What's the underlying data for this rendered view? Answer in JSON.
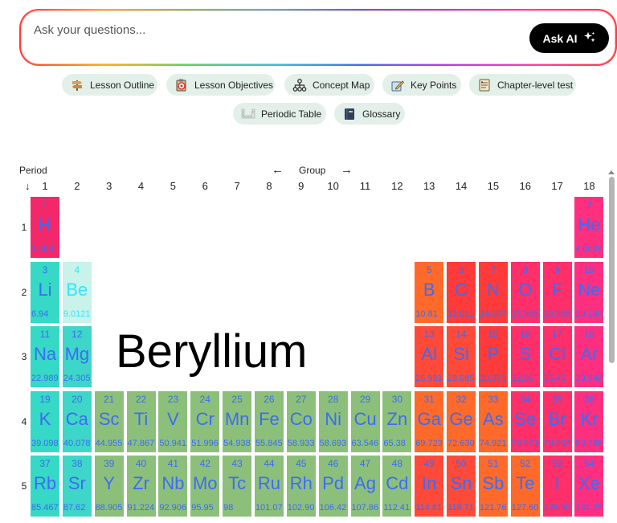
{
  "ask": {
    "placeholder": "Ask your questions...",
    "button_label": "Ask AI",
    "button_icon": "sparkles-icon"
  },
  "chips": [
    {
      "label": "Lesson Outline",
      "icon": "signpost-icon"
    },
    {
      "label": "Lesson Objectives",
      "icon": "target-clipboard-icon"
    },
    {
      "label": "Concept Map",
      "icon": "hierarchy-icon"
    },
    {
      "label": "Key Points",
      "icon": "pencil-note-icon"
    },
    {
      "label": "Chapter-level test",
      "icon": "test-sheet-icon"
    },
    {
      "label": "Periodic Table",
      "icon": "periodic-grid-icon"
    },
    {
      "label": "Glossary",
      "icon": "book-icon"
    }
  ],
  "table": {
    "period_label": "Period",
    "period_arrow": "↓",
    "group_label": "Group",
    "group_left_arrow": "←",
    "group_right_arrow": "→",
    "groups": [
      "1",
      "2",
      "3",
      "4",
      "5",
      "6",
      "7",
      "8",
      "9",
      "10",
      "11",
      "12",
      "13",
      "14",
      "15",
      "16",
      "17",
      "18"
    ],
    "periods": [
      "1",
      "2",
      "3",
      "4",
      "5"
    ],
    "hover_name": "Beryllium",
    "colors": {
      "alkali": "#36d8c6",
      "alkaline": "#3ed6c8",
      "beryllium": "#c8f2ea",
      "transition": "#8cc07a",
      "post_transition": "#ff6a2a",
      "metalloid": "#ff4a3a",
      "nonmetal": "#ff3a3a",
      "halogen": "#ff2f6a",
      "noble": "#ff2f80",
      "hydrogen": "#f2286a"
    },
    "elements": [
      {
        "z": "1",
        "sym": "H",
        "mass": "1.008",
        "group": 1,
        "period": 1,
        "color": "hydrogen"
      },
      {
        "z": "2",
        "sym": "He",
        "mass": "4.0026",
        "group": 18,
        "period": 1,
        "color": "noble"
      },
      {
        "z": "3",
        "sym": "Li",
        "mass": "6.94",
        "group": 1,
        "period": 2,
        "color": "alkali"
      },
      {
        "z": "4",
        "sym": "Be",
        "mass": "9.0121",
        "group": 2,
        "period": 2,
        "color": "beryllium",
        "light": true
      },
      {
        "z": "5",
        "sym": "B",
        "mass": "10.81",
        "group": 13,
        "period": 2,
        "color": "post_transition"
      },
      {
        "z": "6",
        "sym": "C",
        "mass": "12.011",
        "group": 14,
        "period": 2,
        "color": "nonmetal"
      },
      {
        "z": "7",
        "sym": "N",
        "mass": "14.007",
        "group": 15,
        "period": 2,
        "color": "nonmetal"
      },
      {
        "z": "8",
        "sym": "O",
        "mass": "15.999",
        "group": 16,
        "period": 2,
        "color": "halogen"
      },
      {
        "z": "9",
        "sym": "F",
        "mass": "18.998",
        "group": 17,
        "period": 2,
        "color": "halogen"
      },
      {
        "z": "10",
        "sym": "Ne",
        "mass": "20.180",
        "group": 18,
        "period": 2,
        "color": "noble"
      },
      {
        "z": "11",
        "sym": "Na",
        "mass": "22.989",
        "group": 1,
        "period": 3,
        "color": "alkali"
      },
      {
        "z": "12",
        "sym": "Mg",
        "mass": "24.305",
        "group": 2,
        "period": 3,
        "color": "alkaline"
      },
      {
        "z": "13",
        "sym": "Al",
        "mass": "26.981",
        "group": 13,
        "period": 3,
        "color": "metalloid"
      },
      {
        "z": "14",
        "sym": "Si",
        "mass": "28.085",
        "group": 14,
        "period": 3,
        "color": "metalloid"
      },
      {
        "z": "15",
        "sym": "P",
        "mass": "30.973",
        "group": 15,
        "period": 3,
        "color": "nonmetal"
      },
      {
        "z": "16",
        "sym": "S",
        "mass": "32.06",
        "group": 16,
        "period": 3,
        "color": "halogen"
      },
      {
        "z": "17",
        "sym": "Cl",
        "mass": "35.45",
        "group": 17,
        "period": 3,
        "color": "halogen"
      },
      {
        "z": "18",
        "sym": "Ar",
        "mass": "39.948",
        "group": 18,
        "period": 3,
        "color": "noble"
      },
      {
        "z": "19",
        "sym": "K",
        "mass": "39.098",
        "group": 1,
        "period": 4,
        "color": "alkali"
      },
      {
        "z": "20",
        "sym": "Ca",
        "mass": "40.078",
        "group": 2,
        "period": 4,
        "color": "alkaline"
      },
      {
        "z": "21",
        "sym": "Sc",
        "mass": "44.955",
        "group": 3,
        "period": 4,
        "color": "transition"
      },
      {
        "z": "22",
        "sym": "Ti",
        "mass": "47.867",
        "group": 4,
        "period": 4,
        "color": "transition"
      },
      {
        "z": "23",
        "sym": "V",
        "mass": "50.941",
        "group": 5,
        "period": 4,
        "color": "transition"
      },
      {
        "z": "24",
        "sym": "Cr",
        "mass": "51.996",
        "group": 6,
        "period": 4,
        "color": "transition"
      },
      {
        "z": "25",
        "sym": "Mn",
        "mass": "54.938",
        "group": 7,
        "period": 4,
        "color": "transition"
      },
      {
        "z": "26",
        "sym": "Fe",
        "mass": "55.845",
        "group": 8,
        "period": 4,
        "color": "transition"
      },
      {
        "z": "27",
        "sym": "Co",
        "mass": "58.933",
        "group": 9,
        "period": 4,
        "color": "transition"
      },
      {
        "z": "28",
        "sym": "Ni",
        "mass": "58.693",
        "group": 10,
        "period": 4,
        "color": "transition"
      },
      {
        "z": "29",
        "sym": "Cu",
        "mass": "63.546",
        "group": 11,
        "period": 4,
        "color": "transition"
      },
      {
        "z": "30",
        "sym": "Zn",
        "mass": "65.38",
        "group": 12,
        "period": 4,
        "color": "transition"
      },
      {
        "z": "31",
        "sym": "Ga",
        "mass": "69.723",
        "group": 13,
        "period": 4,
        "color": "post_transition"
      },
      {
        "z": "32",
        "sym": "Ge",
        "mass": "72.630",
        "group": 14,
        "period": 4,
        "color": "post_transition"
      },
      {
        "z": "33",
        "sym": "As",
        "mass": "74.921",
        "group": 15,
        "period": 4,
        "color": "post_transition"
      },
      {
        "z": "34",
        "sym": "Se",
        "mass": "78.971",
        "group": 16,
        "period": 4,
        "color": "halogen"
      },
      {
        "z": "35",
        "sym": "Br",
        "mass": "79.904",
        "group": 17,
        "period": 4,
        "color": "halogen"
      },
      {
        "z": "36",
        "sym": "Kr",
        "mass": "83.798",
        "group": 18,
        "period": 4,
        "color": "noble"
      },
      {
        "z": "37",
        "sym": "Rb",
        "mass": "85.467",
        "group": 1,
        "period": 5,
        "color": "alkali"
      },
      {
        "z": "38",
        "sym": "Sr",
        "mass": "87.62",
        "group": 2,
        "period": 5,
        "color": "alkaline"
      },
      {
        "z": "39",
        "sym": "Y",
        "mass": "88.905",
        "group": 3,
        "period": 5,
        "color": "transition"
      },
      {
        "z": "40",
        "sym": "Zr",
        "mass": "91.224",
        "group": 4,
        "period": 5,
        "color": "transition"
      },
      {
        "z": "41",
        "sym": "Nb",
        "mass": "92.906",
        "group": 5,
        "period": 5,
        "color": "transition"
      },
      {
        "z": "42",
        "sym": "Mo",
        "mass": "95.95",
        "group": 6,
        "period": 5,
        "color": "transition"
      },
      {
        "z": "43",
        "sym": "Tc",
        "mass": "98",
        "group": 7,
        "period": 5,
        "color": "transition"
      },
      {
        "z": "44",
        "sym": "Ru",
        "mass": "101.07",
        "group": 8,
        "period": 5,
        "color": "transition"
      },
      {
        "z": "45",
        "sym": "Rh",
        "mass": "102.90",
        "group": 9,
        "period": 5,
        "color": "transition"
      },
      {
        "z": "46",
        "sym": "Pd",
        "mass": "106.42",
        "group": 10,
        "period": 5,
        "color": "transition"
      },
      {
        "z": "47",
        "sym": "Ag",
        "mass": "107.86",
        "group": 11,
        "period": 5,
        "color": "transition"
      },
      {
        "z": "48",
        "sym": "Cd",
        "mass": "112.41",
        "group": 12,
        "period": 5,
        "color": "transition"
      },
      {
        "z": "49",
        "sym": "In",
        "mass": "114.81",
        "group": 13,
        "period": 5,
        "color": "metalloid"
      },
      {
        "z": "50",
        "sym": "Sn",
        "mass": "118.71",
        "group": 14,
        "period": 5,
        "color": "metalloid"
      },
      {
        "z": "51",
        "sym": "Sb",
        "mass": "121.76",
        "group": 15,
        "period": 5,
        "color": "post_transition"
      },
      {
        "z": "52",
        "sym": "Te",
        "mass": "127.60",
        "group": 16,
        "period": 5,
        "color": "post_transition"
      },
      {
        "z": "53",
        "sym": "I",
        "mass": "126.90",
        "group": 17,
        "period": 5,
        "color": "halogen"
      },
      {
        "z": "54",
        "sym": "Xe",
        "mass": "131.29",
        "group": 18,
        "period": 5,
        "color": "noble"
      }
    ]
  }
}
